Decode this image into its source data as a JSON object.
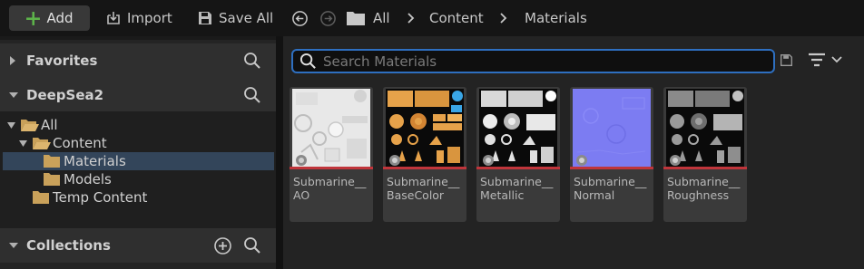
{
  "toolbar": {
    "add_label": "Add",
    "import_label": "Import",
    "save_all_label": "Save All",
    "breadcrumbs": [
      "All",
      "Content",
      "Materials"
    ]
  },
  "left_panel": {
    "favorites_label": "Favorites",
    "project_label": "DeepSea2",
    "tree": [
      {
        "label": "All",
        "selected": false
      },
      {
        "label": "Content",
        "selected": false
      },
      {
        "label": "Materials",
        "selected": true
      },
      {
        "label": "Models",
        "selected": false
      },
      {
        "label": "Temp Content",
        "selected": false
      }
    ],
    "collections_label": "Collections"
  },
  "content_browser": {
    "search_placeholder": "Search Materials",
    "assets": [
      {
        "line1": "Submarine__",
        "line2": "AO",
        "thumb": "ao"
      },
      {
        "line1": "Submarine__",
        "line2": "BaseColor",
        "thumb": "basecolor"
      },
      {
        "line1": "Submarine__",
        "line2": "Metallic",
        "thumb": "metallic"
      },
      {
        "line1": "Submarine__",
        "line2": "Normal",
        "thumb": "normal"
      },
      {
        "line1": "Submarine__",
        "line2": "Roughness",
        "thumb": "roughness"
      }
    ]
  },
  "colors": {
    "accent": "#2e6fc0",
    "selection": "#33455a",
    "asset_type_bar": "#c0353b",
    "add_icon": "#5db34a",
    "folder": "#c9a15a"
  },
  "icons": [
    "plus-icon",
    "import-icon",
    "save-icon",
    "back-icon",
    "forward-icon",
    "folder-icon",
    "chevron-right-icon",
    "search-icon",
    "filter-icon",
    "chevron-down-icon",
    "triangle-right-icon",
    "triangle-down-icon",
    "add-circle-icon"
  ]
}
